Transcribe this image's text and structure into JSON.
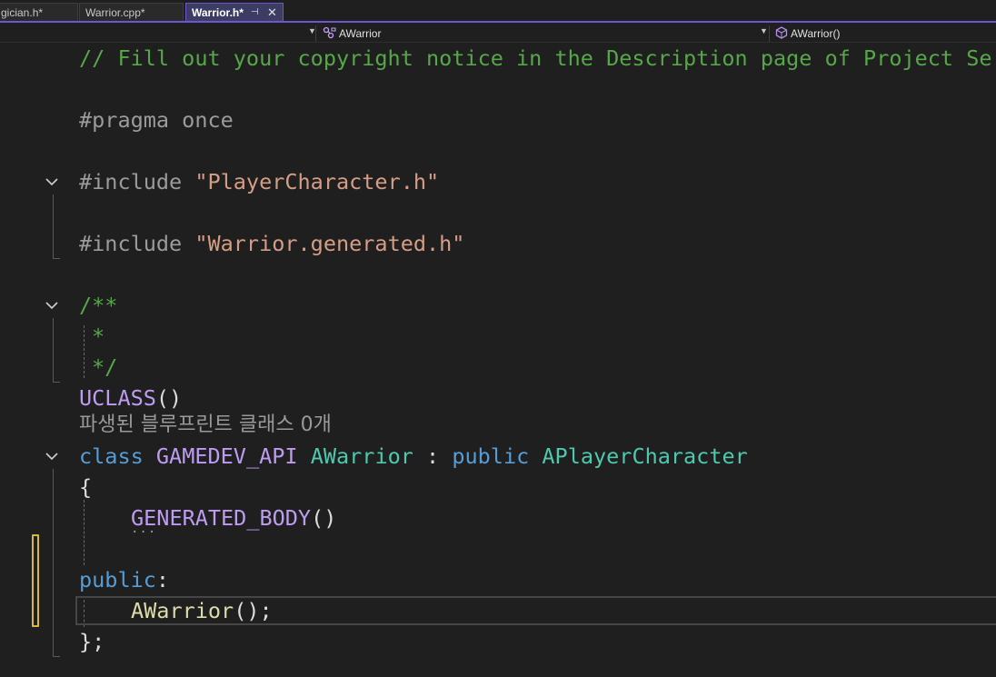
{
  "tabs": [
    {
      "label": "gician.h*",
      "active": false
    },
    {
      "label": "Warrior.cpp*",
      "active": false
    },
    {
      "label": "Warrior.h*",
      "active": true
    }
  ],
  "tab_pin_glyph": "⊣",
  "tab_close_glyph": "✕",
  "nav": {
    "class_scope": "AWarrior",
    "member_scope": "AWarrior()",
    "class_icon": "class-icon",
    "member_icon": "method-icon"
  },
  "code": {
    "line1": "// Fill out your copyright notice in the Description page of Project Se",
    "pragma": "#pragma once",
    "include1_kw": "#include ",
    "include1_str": "\"PlayerCharacter.h\"",
    "include2_kw": "#include ",
    "include2_str": "\"Warrior.generated.h\"",
    "doc_open": "/**",
    "doc_mid": "*",
    "doc_close": "*/",
    "uclass": "UCLASS",
    "uclass_parens": "()",
    "codelens": "파생된 블루프린트 클래스 0개",
    "class_kw": "class",
    "api_macro": "GAMEDEV_API",
    "class_name": "AWarrior",
    "colon": ":",
    "public_kw": "public",
    "base_class": "APlayerCharacter",
    "open_brace": "{",
    "generated_body": "GENERATED_BODY",
    "generated_parens": "()",
    "ellipsis": "...",
    "public_label": "public",
    "public_colon": ":",
    "ctor": "AWarrior",
    "ctor_tail": "();",
    "close_brace": "};"
  },
  "colors": {
    "comment": "#57a64a",
    "keyword": "#569cd6",
    "type": "#4ec9b0",
    "macro": "#bd9cf2",
    "string": "#d69d85",
    "tab_accent": "#6e56cf",
    "change_marker": "#d7ba3b"
  }
}
